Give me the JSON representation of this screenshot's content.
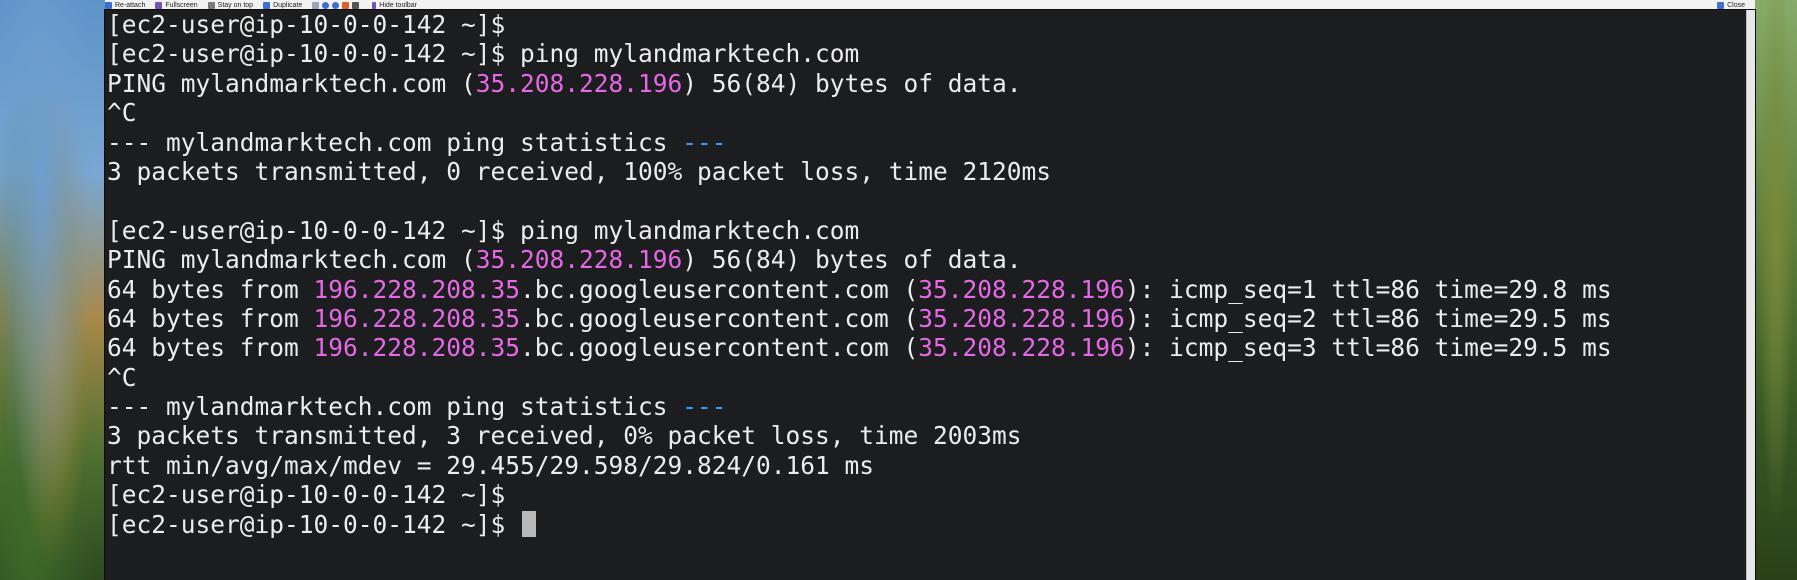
{
  "toolbar": {
    "items": [
      {
        "label": "Re-attach",
        "icon": "reattach-icon",
        "color": "#3b6fd0"
      },
      {
        "label": "Fullscreen",
        "icon": "fullscreen-icon",
        "color": "#7a4fb8"
      },
      {
        "label": "Stay on top",
        "icon": "pin-icon",
        "color": "#7a7a7a"
      },
      {
        "label": "Duplicate",
        "icon": "duplicate-icon",
        "color": "#3b6fd0"
      }
    ],
    "hide_label": "Hide toolbar",
    "close_label": "Close"
  },
  "terminal": {
    "prompt": "[ec2-user@ip-10-0-0-142 ~]$",
    "lines": [
      {
        "t": "prompt",
        "text": ""
      },
      {
        "t": "prompt",
        "text": " ping mylandmarktech.com"
      },
      {
        "t": "pinghdr",
        "pre": "PING mylandmarktech.com (",
        "ip": "35.208.228.196",
        "post": ") 56(84) bytes of data."
      },
      {
        "t": "plain",
        "text": "^C"
      },
      {
        "t": "stats",
        "pre": "--- mylandmarktech.com ping statistics ",
        "dash": "---"
      },
      {
        "t": "plain",
        "text": "3 packets transmitted, 0 received, 100% packet loss, time 2120ms"
      },
      {
        "t": "plain",
        "text": ""
      },
      {
        "t": "prompt",
        "text": " ping mylandmarktech.com"
      },
      {
        "t": "pinghdr",
        "pre": "PING mylandmarktech.com (",
        "ip": "35.208.228.196",
        "post": ") 56(84) bytes of data."
      },
      {
        "t": "reply",
        "pre": "64 bytes from ",
        "rev": "196.228.208.35",
        "mid": ".bc.googleusercontent.com (",
        "ip": "35.208.228.196",
        "post": "): icmp_seq=1 ttl=86 time=29.8 ms"
      },
      {
        "t": "reply",
        "pre": "64 bytes from ",
        "rev": "196.228.208.35",
        "mid": ".bc.googleusercontent.com (",
        "ip": "35.208.228.196",
        "post": "): icmp_seq=2 ttl=86 time=29.5 ms"
      },
      {
        "t": "reply",
        "pre": "64 bytes from ",
        "rev": "196.228.208.35",
        "mid": ".bc.googleusercontent.com (",
        "ip": "35.208.228.196",
        "post": "): icmp_seq=3 ttl=86 time=29.5 ms"
      },
      {
        "t": "plain",
        "text": "^C"
      },
      {
        "t": "stats",
        "pre": "--- mylandmarktech.com ping statistics ",
        "dash": "---"
      },
      {
        "t": "plain",
        "text": "3 packets transmitted, 3 received, 0% packet loss, time 2003ms"
      },
      {
        "t": "plain",
        "text": "rtt min/avg/max/mdev = 29.455/29.598/29.824/0.161 ms"
      },
      {
        "t": "prompt",
        "text": ""
      },
      {
        "t": "prompt",
        "text": " ",
        "cursor": true
      }
    ]
  },
  "colors": {
    "background": "#1c1d1f",
    "text": "#ececec",
    "ip_highlight": "#e668e6",
    "dash_highlight": "#3aa0ff",
    "cursor": "#b9b9b9"
  }
}
